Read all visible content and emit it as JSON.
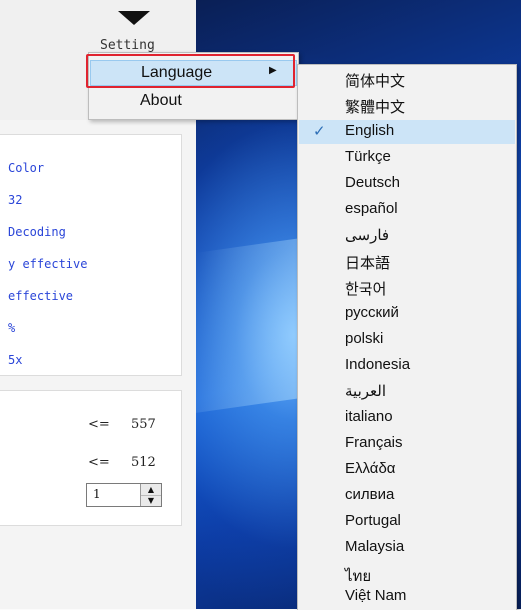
{
  "app": {
    "setting_label": "Setting",
    "settings_lines": [
      "Color",
      "32",
      "Decoding",
      "y effective",
      "effective",
      "%",
      "5x"
    ],
    "compare": [
      {
        "op": "<=",
        "value": "557"
      },
      {
        "op": "<=",
        "value": "512"
      }
    ],
    "spinner_value": "1"
  },
  "menu": {
    "items": [
      {
        "label": "Language",
        "has_submenu": true
      },
      {
        "label": "About",
        "has_submenu": false
      }
    ]
  },
  "language_menu": {
    "items": [
      {
        "label": "简体中文",
        "checked": false
      },
      {
        "label": "繁體中文",
        "checked": false
      },
      {
        "label": "English",
        "checked": true
      },
      {
        "label": "Türkçe",
        "checked": false
      },
      {
        "label": "Deutsch",
        "checked": false
      },
      {
        "label": "español",
        "checked": false
      },
      {
        "label": "فارسی",
        "checked": false
      },
      {
        "label": "日本語",
        "checked": false
      },
      {
        "label": "한국어",
        "checked": false
      },
      {
        "label": "русский",
        "checked": false
      },
      {
        "label": "polski",
        "checked": false
      },
      {
        "label": "Indonesia",
        "checked": false
      },
      {
        "label": "العربية",
        "checked": false
      },
      {
        "label": "italiano",
        "checked": false
      },
      {
        "label": "Français",
        "checked": false
      },
      {
        "label": "Ελλάδα",
        "checked": false
      },
      {
        "label": "силвиа",
        "checked": false
      },
      {
        "label": "Portugal",
        "checked": false
      },
      {
        "label": "Malaysia",
        "checked": false
      },
      {
        "label": "ไทย",
        "checked": false
      },
      {
        "label": "Việt Nam",
        "checked": false
      }
    ]
  },
  "colors": {
    "highlight": "#cce4f7",
    "red_outline": "#e0232f",
    "link_text": "#2a45d8",
    "check": "#2e6fb6"
  }
}
